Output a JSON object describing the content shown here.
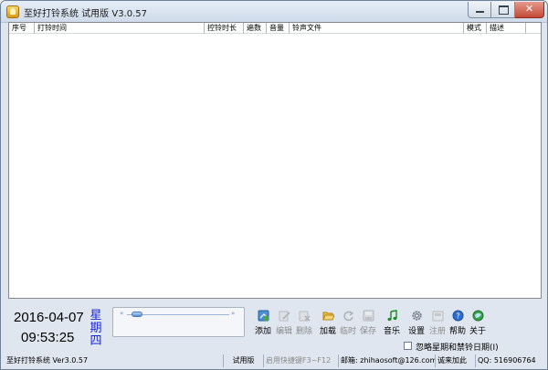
{
  "window": {
    "title": "至好打铃系统 试用版 V3.0.57",
    "minimize_label": "",
    "maximize_label": "",
    "close_label": "✕"
  },
  "list": {
    "columns": [
      "序号",
      "打铃时间",
      "控铃时长",
      "遍数",
      "音量",
      "铃声文件",
      "模式",
      "描述"
    ]
  },
  "clock": {
    "date": "2016-04-07",
    "time": "09:53:25",
    "weekday_chars": [
      "星",
      "期",
      "四"
    ]
  },
  "player": {
    "rewind_glyph": "«",
    "forward_glyph": "»",
    "position": 0.05
  },
  "toolbar": {
    "items": [
      {
        "label": "添加",
        "icon": "add-icon",
        "enabled": true
      },
      {
        "label": "编辑",
        "icon": "edit-icon",
        "enabled": false
      },
      {
        "label": "删除",
        "icon": "delete-icon",
        "enabled": false
      },
      {
        "label": "加载",
        "icon": "folder-open-icon",
        "enabled": true
      },
      {
        "label": "临时",
        "icon": "refresh-icon",
        "enabled": false
      },
      {
        "label": "保存",
        "icon": "save-icon",
        "enabled": false
      },
      {
        "label": "音乐",
        "icon": "music-note-icon",
        "enabled": true
      },
      {
        "label": "设置",
        "icon": "gear-icon",
        "enabled": true
      },
      {
        "label": "注册",
        "icon": "register-icon",
        "enabled": false
      },
      {
        "label": "帮助",
        "icon": "help-icon",
        "enabled": true
      },
      {
        "label": "关于",
        "icon": "about-icon",
        "enabled": true
      }
    ]
  },
  "options": {
    "ignore_label": "忽略星期和禁铃日期(I)",
    "ignore_checked": false
  },
  "status_bar": {
    "app_version": "至好打铃系统 Ver3.0.57",
    "edition": "试用版",
    "hotkey_hint": "启用快捷键F3~F12",
    "email": "邮箱: zhihaosoft@126.com",
    "join": "   诚来加此",
    "qq": "QQ: 516906764"
  },
  "colors": {
    "weekday": "#1a25d6",
    "window_bg": "#dfe6ef",
    "close_button": "#c34a36"
  }
}
